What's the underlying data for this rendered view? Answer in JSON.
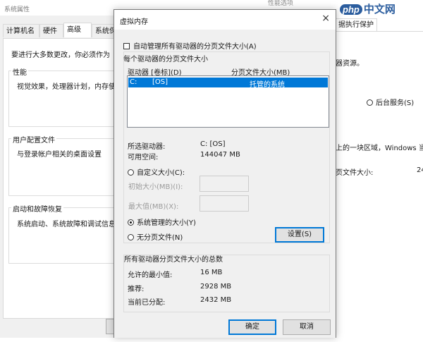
{
  "sysprops": {
    "title": "系统属性",
    "tabs": [
      "计算机名",
      "硬件",
      "高级",
      "系统保"
    ],
    "intro": "要进行大多数更改，你必须作为",
    "groups": [
      {
        "title": "性能",
        "desc": "视觉效果，处理器计划，内存使"
      },
      {
        "title": "用户配置文件",
        "desc": "与登录帐户相关的桌面设置"
      },
      {
        "title": "启动和故障恢复",
        "desc": "系统启动、系统故障和调试信息"
      }
    ]
  },
  "perfopts": {
    "title": "性能选项",
    "tab": "据执行保护",
    "line1": "器资源。",
    "radio_bg": "后台服务(S)",
    "line2": "上的一块区域，Windows 当作",
    "line3": "页文件大小:",
    "line3_val": "24"
  },
  "watermark": {
    "badge": "php",
    "text": "中文网"
  },
  "vm": {
    "title": "虚拟内存",
    "close": "×",
    "auto_manage": "自动管理所有驱动器的分页文件大小(A)",
    "section_title": "每个驱动器的分页文件大小",
    "col_drive": "驱动器 [卷标](D)",
    "col_size": "分页文件大小(MB)",
    "drive_row": {
      "drive": "C:",
      "label": "[OS]",
      "size": "托管的系统"
    },
    "selected_drive_label": "所选驱动器:",
    "selected_drive_value": "C:  [OS]",
    "free_space_label": "可用空间:",
    "free_space_value": "144047 MB",
    "custom_size": "自定义大小(C):",
    "initial_size": "初始大小(MB)(I):",
    "max_size": "最大值(MB)(X):",
    "system_managed": "系统管理的大小(Y)",
    "no_paging": "无分页文件(N)",
    "set_button": "设置(S)",
    "total_title": "所有驱动器分页文件大小的总数",
    "min_allowed_label": "允许的最小值:",
    "min_allowed_value": "16 MB",
    "recommended_label": "推荐:",
    "recommended_value": "2928 MB",
    "current_label": "当前已分配:",
    "current_value": "2432 MB",
    "ok": "确定",
    "cancel": "取消"
  },
  "colors": {
    "selection": "#0078d7",
    "dialog_bg": "#f0f0f0"
  }
}
